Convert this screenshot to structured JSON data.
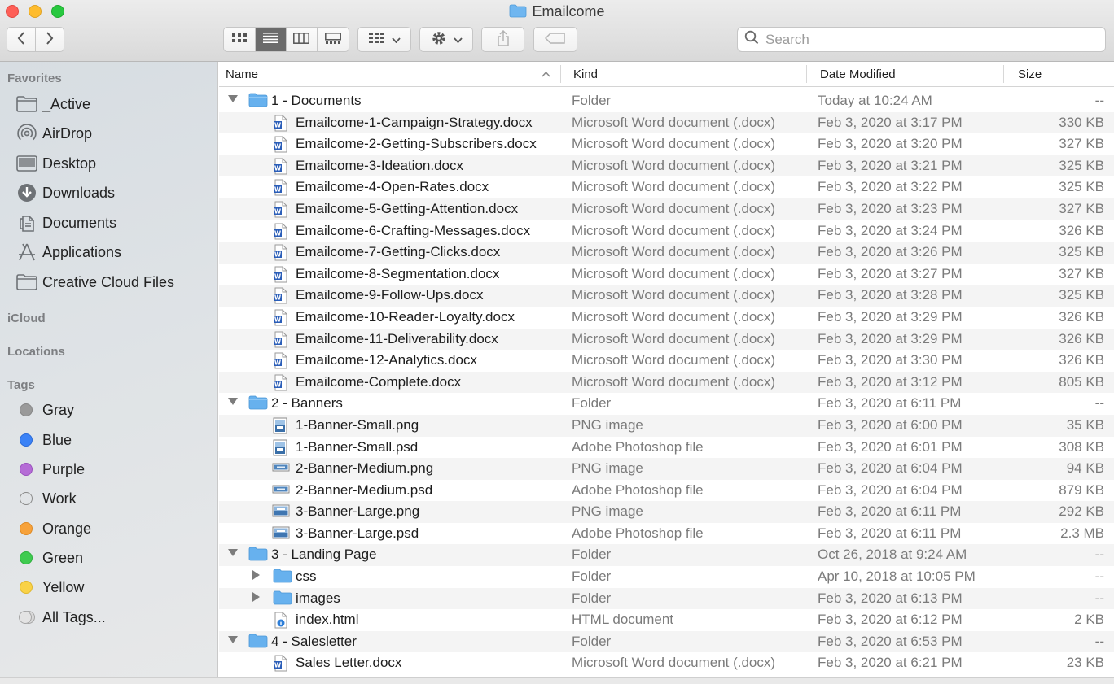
{
  "window": {
    "title": "Emailcome"
  },
  "toolbar": {
    "search_placeholder": "Search",
    "colors": {
      "active_view": "#6b6b6b"
    }
  },
  "sidebar": {
    "sections": {
      "favorites": "Favorites",
      "icloud": "iCloud",
      "locations": "Locations",
      "tags": "Tags"
    },
    "favorites": [
      {
        "label": "_Active",
        "icon": "folder-icon"
      },
      {
        "label": "AirDrop",
        "icon": "airdrop-icon"
      },
      {
        "label": "Desktop",
        "icon": "desktop-icon"
      },
      {
        "label": "Downloads",
        "icon": "downloads-icon"
      },
      {
        "label": "Documents",
        "icon": "documents-icon"
      },
      {
        "label": "Applications",
        "icon": "applications-icon"
      },
      {
        "label": "Creative Cloud Files",
        "icon": "folder-icon"
      }
    ],
    "tags": [
      {
        "label": "Gray",
        "color": "#9a9a9a"
      },
      {
        "label": "Blue",
        "color": "#3b82f6"
      },
      {
        "label": "Purple",
        "color": "#b56cd6"
      },
      {
        "label": "Work",
        "color": "#cfcfcf"
      },
      {
        "label": "Orange",
        "color": "#f7a23b"
      },
      {
        "label": "Green",
        "color": "#3fcb50"
      },
      {
        "label": "Yellow",
        "color": "#f9d247"
      },
      {
        "label": "All Tags...",
        "color": "#d0d0d0"
      }
    ]
  },
  "columns": {
    "name": "Name",
    "kind": "Kind",
    "date": "Date Modified",
    "size": "Size"
  },
  "rows": [
    {
      "name": "1 - Documents",
      "kind": "Folder",
      "date": "Today at 10:24 AM",
      "size": "--",
      "type": "folder",
      "level": 0,
      "disclosure": "open"
    },
    {
      "name": "Emailcome-1-Campaign-Strategy.docx",
      "kind": "Microsoft Word document (.docx)",
      "date": "Feb 3, 2020 at 3:17 PM",
      "size": "330 KB",
      "type": "word",
      "level": 1
    },
    {
      "name": "Emailcome-2-Getting-Subscribers.docx",
      "kind": "Microsoft Word document (.docx)",
      "date": "Feb 3, 2020 at 3:20 PM",
      "size": "327 KB",
      "type": "word",
      "level": 1
    },
    {
      "name": "Emailcome-3-Ideation.docx",
      "kind": "Microsoft Word document (.docx)",
      "date": "Feb 3, 2020 at 3:21 PM",
      "size": "325 KB",
      "type": "word",
      "level": 1
    },
    {
      "name": "Emailcome-4-Open-Rates.docx",
      "kind": "Microsoft Word document (.docx)",
      "date": "Feb 3, 2020 at 3:22 PM",
      "size": "325 KB",
      "type": "word",
      "level": 1
    },
    {
      "name": "Emailcome-5-Getting-Attention.docx",
      "kind": "Microsoft Word document (.docx)",
      "date": "Feb 3, 2020 at 3:23 PM",
      "size": "327 KB",
      "type": "word",
      "level": 1
    },
    {
      "name": "Emailcome-6-Crafting-Messages.docx",
      "kind": "Microsoft Word document (.docx)",
      "date": "Feb 3, 2020 at 3:24 PM",
      "size": "326 KB",
      "type": "word",
      "level": 1
    },
    {
      "name": "Emailcome-7-Getting-Clicks.docx",
      "kind": "Microsoft Word document (.docx)",
      "date": "Feb 3, 2020 at 3:26 PM",
      "size": "325 KB",
      "type": "word",
      "level": 1
    },
    {
      "name": "Emailcome-8-Segmentation.docx",
      "kind": "Microsoft Word document (.docx)",
      "date": "Feb 3, 2020 at 3:27 PM",
      "size": "327 KB",
      "type": "word",
      "level": 1
    },
    {
      "name": "Emailcome-9-Follow-Ups.docx",
      "kind": "Microsoft Word document (.docx)",
      "date": "Feb 3, 2020 at 3:28 PM",
      "size": "325 KB",
      "type": "word",
      "level": 1
    },
    {
      "name": "Emailcome-10-Reader-Loyalty.docx",
      "kind": "Microsoft Word document (.docx)",
      "date": "Feb 3, 2020 at 3:29 PM",
      "size": "326 KB",
      "type": "word",
      "level": 1
    },
    {
      "name": "Emailcome-11-Deliverability.docx",
      "kind": "Microsoft Word document (.docx)",
      "date": "Feb 3, 2020 at 3:29 PM",
      "size": "326 KB",
      "type": "word",
      "level": 1
    },
    {
      "name": "Emailcome-12-Analytics.docx",
      "kind": "Microsoft Word document (.docx)",
      "date": "Feb 3, 2020 at 3:30 PM",
      "size": "326 KB",
      "type": "word",
      "level": 1
    },
    {
      "name": "Emailcome-Complete.docx",
      "kind": "Microsoft Word document (.docx)",
      "date": "Feb 3, 2020 at 3:12 PM",
      "size": "805 KB",
      "type": "word",
      "level": 1
    },
    {
      "name": "2 - Banners",
      "kind": "Folder",
      "date": "Feb 3, 2020 at 6:11 PM",
      "size": "--",
      "type": "folder",
      "level": 0,
      "disclosure": "open"
    },
    {
      "name": "1-Banner-Small.png",
      "kind": "PNG image",
      "date": "Feb 3, 2020 at 6:00 PM",
      "size": "35 KB",
      "type": "image-tall",
      "level": 1
    },
    {
      "name": "1-Banner-Small.psd",
      "kind": "Adobe Photoshop file",
      "date": "Feb 3, 2020 at 6:01 PM",
      "size": "308 KB",
      "type": "image-tall",
      "level": 1
    },
    {
      "name": "2-Banner-Medium.png",
      "kind": "PNG image",
      "date": "Feb 3, 2020 at 6:04 PM",
      "size": "94 KB",
      "type": "image-wide",
      "level": 1
    },
    {
      "name": "2-Banner-Medium.psd",
      "kind": "Adobe Photoshop file",
      "date": "Feb 3, 2020 at 6:04 PM",
      "size": "879 KB",
      "type": "image-wide",
      "level": 1
    },
    {
      "name": "3-Banner-Large.png",
      "kind": "PNG image",
      "date": "Feb 3, 2020 at 6:11 PM",
      "size": "292 KB",
      "type": "image",
      "level": 1
    },
    {
      "name": "3-Banner-Large.psd",
      "kind": "Adobe Photoshop file",
      "date": "Feb 3, 2020 at 6:11 PM",
      "size": "2.3 MB",
      "type": "image",
      "level": 1
    },
    {
      "name": "3 - Landing Page",
      "kind": "Folder",
      "date": "Oct 26, 2018 at 9:24 AM",
      "size": "--",
      "type": "folder",
      "level": 0,
      "disclosure": "open"
    },
    {
      "name": "css",
      "kind": "Folder",
      "date": "Apr 10, 2018 at 10:05 PM",
      "size": "--",
      "type": "folder",
      "level": 1,
      "disclosure": "closed"
    },
    {
      "name": "images",
      "kind": "Folder",
      "date": "Feb 3, 2020 at 6:13 PM",
      "size": "--",
      "type": "folder",
      "level": 1,
      "disclosure": "closed"
    },
    {
      "name": "index.html",
      "kind": "HTML document",
      "date": "Feb 3, 2020 at 6:12 PM",
      "size": "2 KB",
      "type": "html",
      "level": 1
    },
    {
      "name": "4 - Salesletter",
      "kind": "Folder",
      "date": "Feb 3, 2020 at 6:53 PM",
      "size": "--",
      "type": "folder",
      "level": 0,
      "disclosure": "open"
    },
    {
      "name": "Sales Letter.docx",
      "kind": "Microsoft Word document (.docx)",
      "date": "Feb 3, 2020 at 6:21 PM",
      "size": "23 KB",
      "type": "word",
      "level": 1
    }
  ]
}
